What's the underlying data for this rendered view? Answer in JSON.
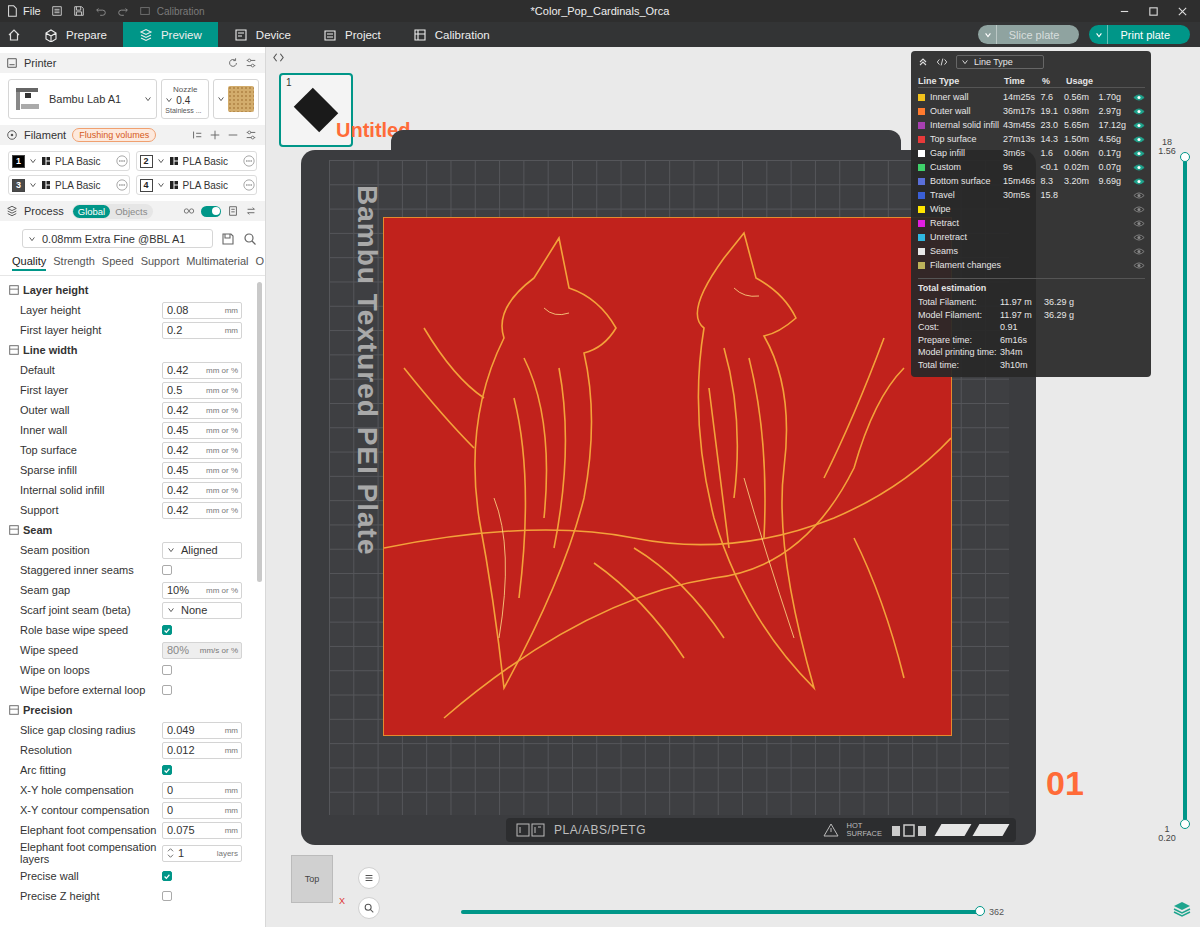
{
  "window": {
    "menu": "File",
    "hint": "Calibration",
    "title": "*Color_Pop_Cardinals_Orca"
  },
  "toolbar": {
    "tabs": [
      {
        "label": "Prepare",
        "selected": false
      },
      {
        "label": "Preview",
        "selected": true
      },
      {
        "label": "Device",
        "selected": false
      },
      {
        "label": "Project",
        "selected": false
      },
      {
        "label": "Calibration",
        "selected": false
      }
    ],
    "buttons": [
      {
        "label": "Slice plate",
        "disabled": true
      },
      {
        "label": "Print plate",
        "disabled": false
      }
    ]
  },
  "printer": {
    "title": "Printer",
    "name": "Bambu Lab A1",
    "nozzle_label": "Nozzle",
    "nozzle": "0.4",
    "nozzle_type": "Stainless ..."
  },
  "filament": {
    "title": "Filament",
    "badge": "Flushing volumes",
    "items": [
      {
        "index": "1",
        "name": "PLA Basic",
        "color": "#000000"
      },
      {
        "index": "2",
        "name": "PLA Basic",
        "color": "#ffffff"
      },
      {
        "index": "3",
        "name": "PLA Basic",
        "color": "#4a4a4a"
      },
      {
        "index": "4",
        "name": "PLA Basic",
        "color": "#ffffff"
      }
    ]
  },
  "process": {
    "title": "Process",
    "scopes": [
      {
        "label": "Global",
        "selected": true
      },
      {
        "label": "Objects",
        "selected": false
      }
    ],
    "advanced": true,
    "preset": "0.08mm Extra Fine @BBL A1",
    "tabs": [
      {
        "label": "Quality",
        "selected": true
      },
      {
        "label": "Strength",
        "selected": false
      },
      {
        "label": "Speed",
        "selected": false
      },
      {
        "label": "Support",
        "selected": false
      },
      {
        "label": "Multimaterial",
        "selected": false
      },
      {
        "label": "O",
        "selected": false
      }
    ]
  },
  "settings": [
    {
      "title": "Layer height",
      "rows": [
        {
          "kind": "input",
          "label": "Layer height",
          "value": "0.08",
          "unit": "mm",
          "disabled": false
        },
        {
          "kind": "input",
          "label": "First layer height",
          "value": "0.2",
          "unit": "mm",
          "disabled": false
        }
      ]
    },
    {
      "title": "Line width",
      "rows": [
        {
          "kind": "input",
          "label": "Default",
          "value": "0.42",
          "unit": "mm or %",
          "disabled": false
        },
        {
          "kind": "input",
          "label": "First layer",
          "value": "0.5",
          "unit": "mm or %",
          "disabled": false
        },
        {
          "kind": "input",
          "label": "Outer wall",
          "value": "0.42",
          "unit": "mm or %",
          "disabled": false
        },
        {
          "kind": "input",
          "label": "Inner wall",
          "value": "0.45",
          "unit": "mm or %",
          "disabled": false
        },
        {
          "kind": "input",
          "label": "Top surface",
          "value": "0.42",
          "unit": "mm or %",
          "disabled": false
        },
        {
          "kind": "input",
          "label": "Sparse infill",
          "value": "0.45",
          "unit": "mm or %",
          "disabled": false
        },
        {
          "kind": "input",
          "label": "Internal solid infill",
          "value": "0.42",
          "unit": "mm or %",
          "disabled": false
        },
        {
          "kind": "input",
          "label": "Support",
          "value": "0.42",
          "unit": "mm or %",
          "disabled": false
        }
      ]
    },
    {
      "title": "Seam",
      "rows": [
        {
          "kind": "select",
          "label": "Seam position",
          "value": "Aligned"
        },
        {
          "kind": "checkbox",
          "label": "Staggered inner seams",
          "checked": false
        },
        {
          "kind": "input",
          "label": "Seam gap",
          "value": "10%",
          "unit": "mm or %",
          "disabled": false
        },
        {
          "kind": "select",
          "label": "Scarf joint seam (beta)",
          "value": "None"
        },
        {
          "kind": "checkbox",
          "label": "Role base wipe speed",
          "checked": true
        },
        {
          "kind": "input",
          "label": "Wipe speed",
          "value": "80%",
          "unit": "mm/s or %",
          "disabled": true
        },
        {
          "kind": "checkbox",
          "label": "Wipe on loops",
          "checked": false
        },
        {
          "kind": "checkbox",
          "label": "Wipe before external loop",
          "checked": false
        }
      ]
    },
    {
      "title": "Precision",
      "rows": [
        {
          "kind": "input",
          "label": "Slice gap closing radius",
          "value": "0.049",
          "unit": "mm",
          "disabled": false
        },
        {
          "kind": "input",
          "label": "Resolution",
          "value": "0.012",
          "unit": "mm",
          "disabled": false
        },
        {
          "kind": "checkbox",
          "label": "Arc fitting",
          "checked": true
        },
        {
          "kind": "input",
          "label": "X-Y hole compensation",
          "value": "0",
          "unit": "mm",
          "disabled": false
        },
        {
          "kind": "input",
          "label": "X-Y contour compensation",
          "value": "0",
          "unit": "mm",
          "disabled": false
        },
        {
          "kind": "input",
          "label": "Elephant foot compensation",
          "value": "0.075",
          "unit": "mm",
          "disabled": false
        },
        {
          "kind": "spinner",
          "label": "Elephant foot compensation layers",
          "value": "1",
          "unit": "layers"
        },
        {
          "kind": "checkbox",
          "label": "Precise wall",
          "checked": true
        },
        {
          "kind": "checkbox",
          "label": "Precise Z height",
          "checked": false
        }
      ]
    }
  ],
  "viewport": {
    "plate_number": "1",
    "plate_name": "Untitled",
    "plate_brand": "Bambu Textured PEI Plate",
    "plate_index": "01",
    "plate_materials": "PLA/ABS/PETG",
    "hot_label": "HOT",
    "hot_sub": "SURFACE",
    "view": "Top",
    "axis": "X",
    "layer_slider": {
      "top_layer": "18",
      "top_height": "1.56",
      "bottom_layer": "1",
      "bottom_height": "0.20",
      "level": 1
    },
    "move_slider": {
      "value": "362",
      "level": 1
    }
  },
  "legend": {
    "mode": "Line Type",
    "columns": [
      "Line Type",
      "Time",
      "%",
      "Usage"
    ],
    "rows": [
      {
        "name": "Inner wall",
        "time": "14m25s",
        "pct": "7.6",
        "length": "0.56m",
        "weight": "1.70g",
        "color": "#f2c21c",
        "visible": true
      },
      {
        "name": "Outer wall",
        "time": "36m17s",
        "pct": "19.1",
        "length": "0.98m",
        "weight": "2.97g",
        "color": "#ff7a2e",
        "visible": true
      },
      {
        "name": "Internal solid infill",
        "time": "43m45s",
        "pct": "23.0",
        "length": "5.65m",
        "weight": "17.12g",
        "color": "#a73fb0",
        "visible": true
      },
      {
        "name": "Top surface",
        "time": "27m13s",
        "pct": "14.3",
        "length": "1.50m",
        "weight": "4.56g",
        "color": "#e83a3a",
        "visible": true
      },
      {
        "name": "Gap infill",
        "time": "3m6s",
        "pct": "1.6",
        "length": "0.06m",
        "weight": "0.17g",
        "color": "#ffffff",
        "visible": true
      },
      {
        "name": "Custom",
        "time": "9s",
        "pct": "<0.1",
        "length": "0.02m",
        "weight": "0.07g",
        "color": "#3fd16a",
        "visible": true
      },
      {
        "name": "Bottom surface",
        "time": "15m46s",
        "pct": "8.3",
        "length": "3.20m",
        "weight": "9.69g",
        "color": "#5a6fd8",
        "visible": true
      },
      {
        "name": "Travel",
        "time": "30m5s",
        "pct": "15.8",
        "color": "#3a5fd6",
        "visible": false
      },
      {
        "name": "Wipe",
        "color": "#ffe600",
        "visible": false
      },
      {
        "name": "Retract",
        "color": "#e21ee0",
        "visible": false
      },
      {
        "name": "Unretract",
        "color": "#30b8e0",
        "visible": false
      },
      {
        "name": "Seams",
        "color": "#e8e8e8",
        "visible": false
      },
      {
        "name": "Filament changes",
        "color": "#bcb25a",
        "visible": false
      }
    ],
    "totals_title": "Total estimation",
    "totals": [
      {
        "label": "Total Filament:",
        "values": [
          "11.97 m",
          "36.29 g"
        ]
      },
      {
        "label": "Model Filament:",
        "values": [
          "11.97 m",
          "36.29 g"
        ]
      },
      {
        "label": "Cost:",
        "values": [
          "0.91"
        ]
      },
      {
        "label": "Prepare time:",
        "values": [
          "6m16s"
        ]
      },
      {
        "label": "Model printing time:",
        "values": [
          "3h4m"
        ]
      },
      {
        "label": "Total time:",
        "values": [
          "3h10m"
        ]
      }
    ]
  }
}
